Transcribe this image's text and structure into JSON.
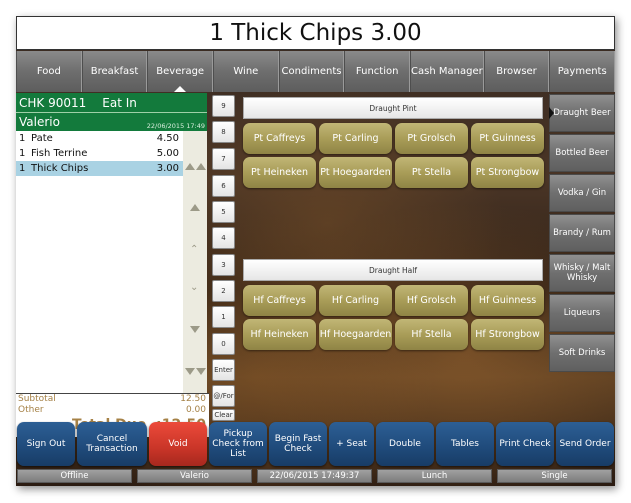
{
  "title": "1 Thick Chips 3.00",
  "nav_tabs": [
    {
      "label": "Food"
    },
    {
      "label": "Breakfast"
    },
    {
      "label": "Beverage",
      "active": true
    },
    {
      "label": "Wine"
    },
    {
      "label": "Condiments"
    },
    {
      "label": "Function"
    },
    {
      "label": "Cash Manager"
    },
    {
      "label": "Browser"
    },
    {
      "label": "Payments"
    }
  ],
  "check": {
    "number": "CHK 90011",
    "mode": "Eat In",
    "server": "Valerio",
    "timestamp": "22/06/2015 17:49",
    "items": [
      {
        "qty": "1",
        "name": "Pate",
        "price": "4.50"
      },
      {
        "qty": "1",
        "name": "Fish Terrine",
        "price": "5.00"
      },
      {
        "qty": "1",
        "name": "Thick Chips",
        "price": "3.00",
        "selected": true
      }
    ],
    "subtotal_label": "Subtotal",
    "subtotal": "12.50",
    "other_label": "Other",
    "other": "0.00",
    "total_label": "Total Due  :",
    "total": "12.50"
  },
  "keypad": [
    "9",
    "8",
    "7",
    "6",
    "5",
    "4",
    "3",
    "2",
    "1",
    "0",
    "Enter",
    "@/For",
    "Clear"
  ],
  "product_groups": [
    {
      "label": "Draught Pint",
      "products": [
        "Pt Caffreys",
        "Pt Carling",
        "Pt Grolsch",
        "Pt Guinness",
        "Pt Heineken",
        "Pt Hoegaarden",
        "Pt Stella",
        "Pt Strongbow"
      ]
    },
    {
      "label": "Draught Half",
      "products": [
        "Hf Caffreys",
        "Hf Carling",
        "Hf Grolsch",
        "Hf Guinness",
        "Hf Heineken",
        "Hf Hoegaarden",
        "Hf Stella",
        "Hf Strongbow"
      ]
    }
  ],
  "categories": [
    {
      "label": "Draught Beer",
      "active": true
    },
    {
      "label": "Bottled Beer"
    },
    {
      "label": "Vodka / Gin"
    },
    {
      "label": "Brandy / Rum"
    },
    {
      "label": "Whisky / Malt Whisky"
    },
    {
      "label": "Liqueurs"
    },
    {
      "label": "Soft Drinks"
    }
  ],
  "actions": [
    {
      "label": "Sign Out"
    },
    {
      "label": "Cancel Transaction"
    },
    {
      "label": "Void",
      "color": "#d63a2c"
    },
    {
      "label": "Pickup Check from List"
    },
    {
      "label": "Begin Fast Check"
    },
    {
      "label": "+ Seat"
    },
    {
      "label": "Double"
    },
    {
      "label": "Tables"
    },
    {
      "label": "Print Check"
    },
    {
      "label": "Send Order"
    }
  ],
  "status_bar": {
    "connection": "Offline",
    "user": "Valerio",
    "datetime": "22/06/2015 17:49:37",
    "period": "Lunch",
    "mode": "Single"
  },
  "colors": {
    "check_header": "#137a3c",
    "selected_row": "#a9d2e3",
    "product_button": "#a99d58",
    "action_button": "#1f4a7a",
    "void_button": "#d63a2c",
    "totals_text": "#a58146"
  }
}
